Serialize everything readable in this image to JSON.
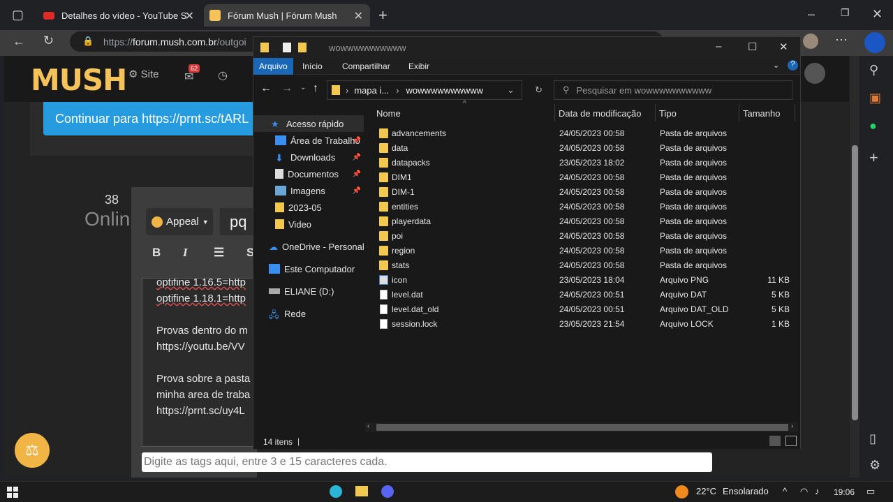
{
  "browser": {
    "tabs": [
      {
        "title": "Detalhes do vídeo - YouTube Stu",
        "active": false
      },
      {
        "title": "Fórum Mush | Fórum Mush",
        "active": true
      }
    ],
    "url_prefix": "https://",
    "url_domain": "forum.mush.com.br",
    "url_rest": "/outgoi"
  },
  "webpage": {
    "logo": "MUSH",
    "nav_site": "Site",
    "notif_badge": "62",
    "continue_button": "Continuar para https://prnt.sc/tARL",
    "online_count": "38",
    "online_label": "Onlin",
    "appeal_button": "Appeal",
    "subject_input": "pq",
    "format_bold": "B",
    "format_italic": "I",
    "editor_lines": [
      "optifine 1.16.5=http",
      "optifine 1.18.1=http",
      "",
      "Provas dentro do m",
      "https://youtu.be/VV",
      "",
      "Prova sobre a pasta",
      "minha area de traba",
      "https://prnt.sc/uy4L"
    ],
    "tags_placeholder": "Digite as tags aqui, entre 3 e 15 caracteres cada."
  },
  "explorer": {
    "title": "wowwwwwwwwww",
    "ribbon_tabs": [
      "Arquivo",
      "Início",
      "Compartilhar",
      "Exibir"
    ],
    "breadcrumb": [
      "mapa i...",
      "wowwwwwwwwww"
    ],
    "search_placeholder": "Pesquisar em wowwwwwwwwww",
    "nav_items": [
      {
        "label": "Acesso rápido",
        "pinned": false
      },
      {
        "label": "Área de Trabalho",
        "pinned": true
      },
      {
        "label": "Downloads",
        "pinned": true
      },
      {
        "label": "Documentos",
        "pinned": true
      },
      {
        "label": "Imagens",
        "pinned": true
      },
      {
        "label": "2023-05",
        "pinned": false
      },
      {
        "label": "Video",
        "pinned": false
      },
      {
        "label": "OneDrive - Personal",
        "pinned": false
      },
      {
        "label": "Este Computador",
        "pinned": false
      },
      {
        "label": "ELIANE (D:)",
        "pinned": false
      },
      {
        "label": "Rede",
        "pinned": false
      }
    ],
    "columns": [
      "Nome",
      "Data de modificação",
      "Tipo",
      "Tamanho"
    ],
    "files": [
      {
        "name": "advancements",
        "date": "24/05/2023 00:58",
        "type": "Pasta de arquivos",
        "size": "",
        "kind": "folder"
      },
      {
        "name": "data",
        "date": "24/05/2023 00:58",
        "type": "Pasta de arquivos",
        "size": "",
        "kind": "folder"
      },
      {
        "name": "datapacks",
        "date": "23/05/2023 18:02",
        "type": "Pasta de arquivos",
        "size": "",
        "kind": "folder"
      },
      {
        "name": "DIM1",
        "date": "24/05/2023 00:58",
        "type": "Pasta de arquivos",
        "size": "",
        "kind": "folder"
      },
      {
        "name": "DIM-1",
        "date": "24/05/2023 00:58",
        "type": "Pasta de arquivos",
        "size": "",
        "kind": "folder"
      },
      {
        "name": "entities",
        "date": "24/05/2023 00:58",
        "type": "Pasta de arquivos",
        "size": "",
        "kind": "folder"
      },
      {
        "name": "playerdata",
        "date": "24/05/2023 00:58",
        "type": "Pasta de arquivos",
        "size": "",
        "kind": "folder"
      },
      {
        "name": "poi",
        "date": "24/05/2023 00:58",
        "type": "Pasta de arquivos",
        "size": "",
        "kind": "folder"
      },
      {
        "name": "region",
        "date": "24/05/2023 00:58",
        "type": "Pasta de arquivos",
        "size": "",
        "kind": "folder"
      },
      {
        "name": "stats",
        "date": "24/05/2023 00:58",
        "type": "Pasta de arquivos",
        "size": "",
        "kind": "folder"
      },
      {
        "name": "icon",
        "date": "23/05/2023 18:04",
        "type": "Arquivo PNG",
        "size": "11 KB",
        "kind": "png"
      },
      {
        "name": "level.dat",
        "date": "24/05/2023 00:51",
        "type": "Arquivo DAT",
        "size": "5 KB",
        "kind": "file"
      },
      {
        "name": "level.dat_old",
        "date": "24/05/2023 00:51",
        "type": "Arquivo DAT_OLD",
        "size": "5 KB",
        "kind": "file"
      },
      {
        "name": "session.lock",
        "date": "23/05/2023 21:54",
        "type": "Arquivo LOCK",
        "size": "1 KB",
        "kind": "file"
      }
    ],
    "status": "14 itens"
  },
  "taskbar": {
    "temperature": "22°C",
    "weather": "Ensolarado",
    "time": "19:06"
  }
}
